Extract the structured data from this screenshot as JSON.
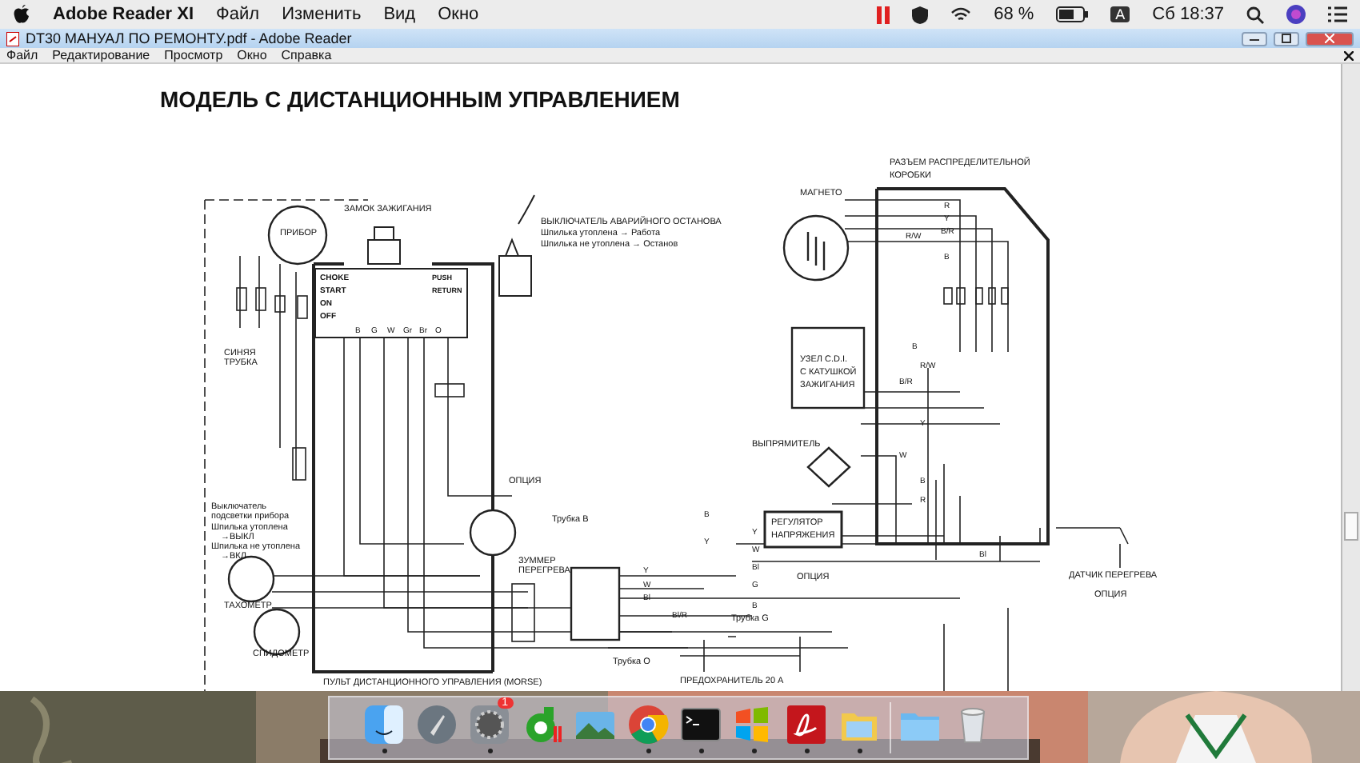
{
  "mac_menubar": {
    "app": "Adobe Reader XI",
    "menus": [
      "Файл",
      "Изменить",
      "Вид",
      "Окно"
    ],
    "battery": "68 %",
    "input_source": "A",
    "clock": "Сб 18:37"
  },
  "window": {
    "title": "DT30 МАНУАЛ ПО РЕМОНТУ.pdf - Adobe Reader"
  },
  "menu": [
    "Файл",
    "Редактирование",
    "Просмотр",
    "Окно",
    "Справка"
  ],
  "document": {
    "heading": "МОДЕЛЬ С ДИСТАНЦИОННЫМ УПРАВЛЕНИЕМ",
    "labels": [
      "ЗАМОК ЗАЖИГАНИЯ",
      "ВЫКЛЮЧАТЕЛЬ АВАРИЙНОГО ОСТАНОВА",
      "Шпилька утоплена → Работа",
      "Шпилька не утоплена → Останов",
      "ПРИБОР",
      "РАЗЪЕМ РАСПРЕДЕЛИТЕЛЬНОЙ",
      "КОРОБКИ",
      "МАГНЕТО",
      "УЗЕЛ C.D.I.",
      "С КАТУШКОЙ",
      "ЗАЖИГАНИЯ",
      "ВЫПРЯМИТЕЛЬ",
      "РЕГУЛЯТОР",
      "НАПРЯЖЕНИЯ",
      "ОПЦИЯ",
      "ДАТЧИК ПЕРЕГРЕВА",
      "ОПЦИЯ",
      "ОПЦИЯ",
      "ЗУММЕР",
      "ПЕРЕГРЕВА",
      "ТАХОМЕТР",
      "СПИДОМЕТР",
      "ПУЛЬТ ДИСТАНЦИОННОГО УПРАВЛЕНИЯ (MORSE)",
      "ПРЕДОХРАНИТЕЛЬ 20 А",
      "СИНЯЯ",
      "ТРУБКА",
      "Выключатель",
      "подсветки прибора",
      "Шпилька утоплена",
      "→ВЫКЛ",
      "Шпилька не утоплена",
      "→ВКЛ",
      "Трубка В",
      "Трубка О",
      "Трубка G"
    ],
    "switch_rows": [
      "CHOKE",
      "START",
      "ON",
      "OFF"
    ],
    "switch_actions": [
      "PUSH",
      "RETURN"
    ],
    "switch_columns": [
      "B",
      "G",
      "W",
      "Gr",
      "Br",
      "O"
    ],
    "wire_labels": [
      "R",
      "Y",
      "B/R",
      "R/W",
      "B",
      "B",
      "R/W",
      "B/R",
      "Y",
      "W",
      "B",
      "R",
      "Bl",
      "Y",
      "W",
      "Bl",
      "G",
      "B",
      "Y",
      "W",
      "Bl",
      "Bl/R",
      "Y",
      "B"
    ]
  },
  "dock": [
    {
      "kind": "finder",
      "running": true
    },
    {
      "kind": "launchpad",
      "running": false
    },
    {
      "kind": "settings",
      "running": true,
      "badge": "1"
    },
    {
      "kind": "ring",
      "running": false
    },
    {
      "kind": "photos",
      "running": false
    },
    {
      "kind": "browser",
      "running": true
    },
    {
      "kind": "terminal",
      "running": true
    },
    {
      "kind": "windows",
      "running": true
    },
    {
      "kind": "pdf",
      "running": true
    },
    {
      "kind": "notes",
      "running": true
    },
    {
      "kind": "separator"
    },
    {
      "kind": "folder",
      "running": false
    },
    {
      "kind": "trash",
      "running": false
    }
  ]
}
